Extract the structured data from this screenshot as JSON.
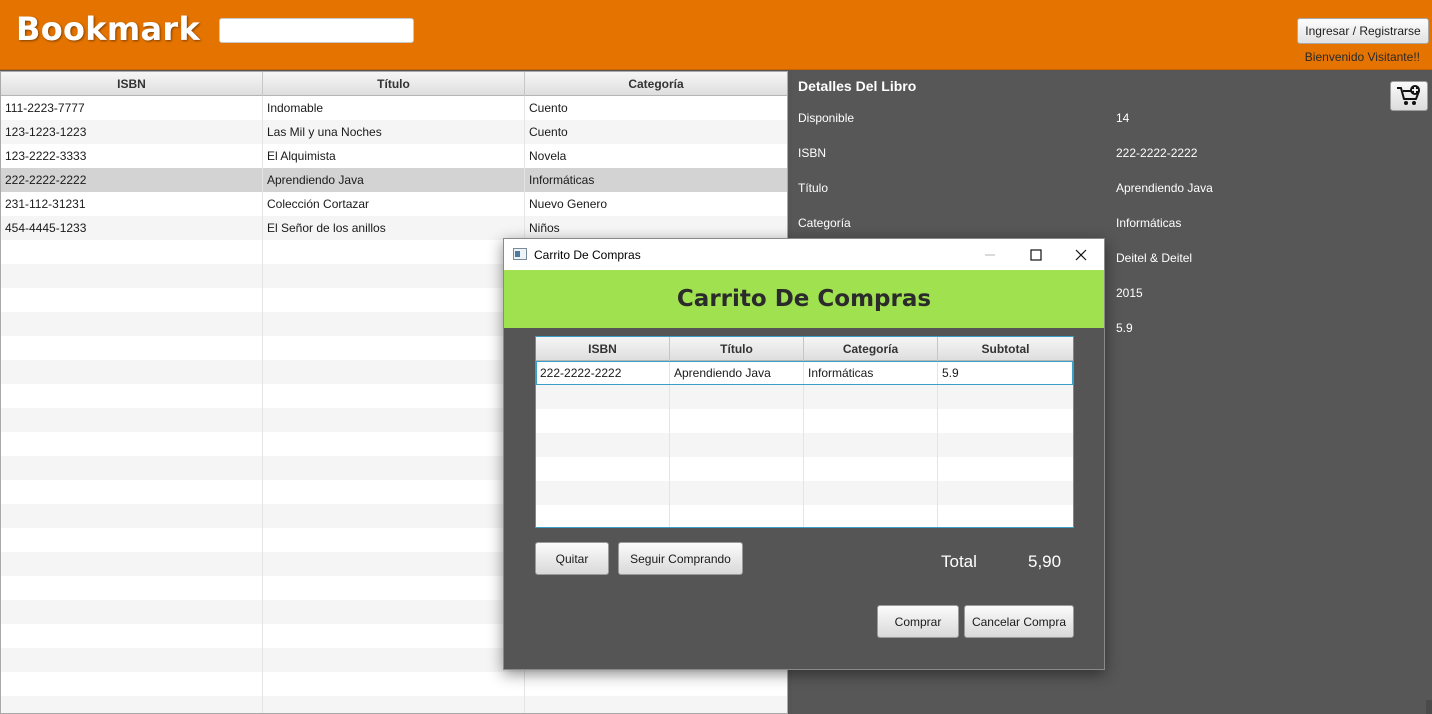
{
  "header": {
    "brand": "Bookmark",
    "search_placeholder": "",
    "search_value": "",
    "login_label": "Ingresar / Registrarse",
    "welcome": "Bienvenido Visitante!!"
  },
  "books_table": {
    "columns": [
      "ISBN",
      "Título",
      "Categoría"
    ],
    "rows": [
      [
        "111-2223-7777",
        "Indomable",
        "Cuento"
      ],
      [
        "123-1223-1223",
        "Las Mil y una Noches",
        "Cuento"
      ],
      [
        "123-2222-3333",
        "El Alquimista",
        "Novela"
      ],
      [
        "222-2222-2222",
        "Aprendiendo Java",
        "Informáticas"
      ],
      [
        "231-112-31231",
        "Colección Cortazar",
        "Nuevo Genero"
      ],
      [
        "454-4445-1233",
        "El Señor de los anillos",
        "Niños"
      ]
    ],
    "selected_index": 3
  },
  "details": {
    "title": "Detalles Del Libro",
    "fields": [
      {
        "label": "Disponible",
        "value": "14"
      },
      {
        "label": "ISBN",
        "value": "222-2222-2222"
      },
      {
        "label": "Título",
        "value": "Aprendiendo Java"
      },
      {
        "label": "Categoría",
        "value": "Informáticas"
      },
      {
        "label": "",
        "value": "Deitel & Deitel"
      },
      {
        "label": "",
        "value": "2015"
      },
      {
        "label": "",
        "value": "5.9"
      }
    ],
    "cart_icon": "cart-add-icon"
  },
  "dialog": {
    "window_title": "Carrito De Compras",
    "banner_title": "Carrito De Compras",
    "columns": [
      "ISBN",
      "Título",
      "Categoría",
      "Subtotal"
    ],
    "rows": [
      [
        "222-2222-2222",
        "Aprendiendo Java",
        "Informáticas",
        "5.9"
      ]
    ],
    "quitar_label": "Quitar",
    "seguir_label": "Seguir Comprando",
    "total_label": "Total",
    "total_value": "5,90",
    "comprar_label": "Comprar",
    "cancelar_label": "Cancelar Compra"
  },
  "colors": {
    "header": "#e57300",
    "banner": "#a0e150",
    "panel": "#575757",
    "selected_row": "#d3d3d3",
    "focus": "#3aa0c8"
  }
}
